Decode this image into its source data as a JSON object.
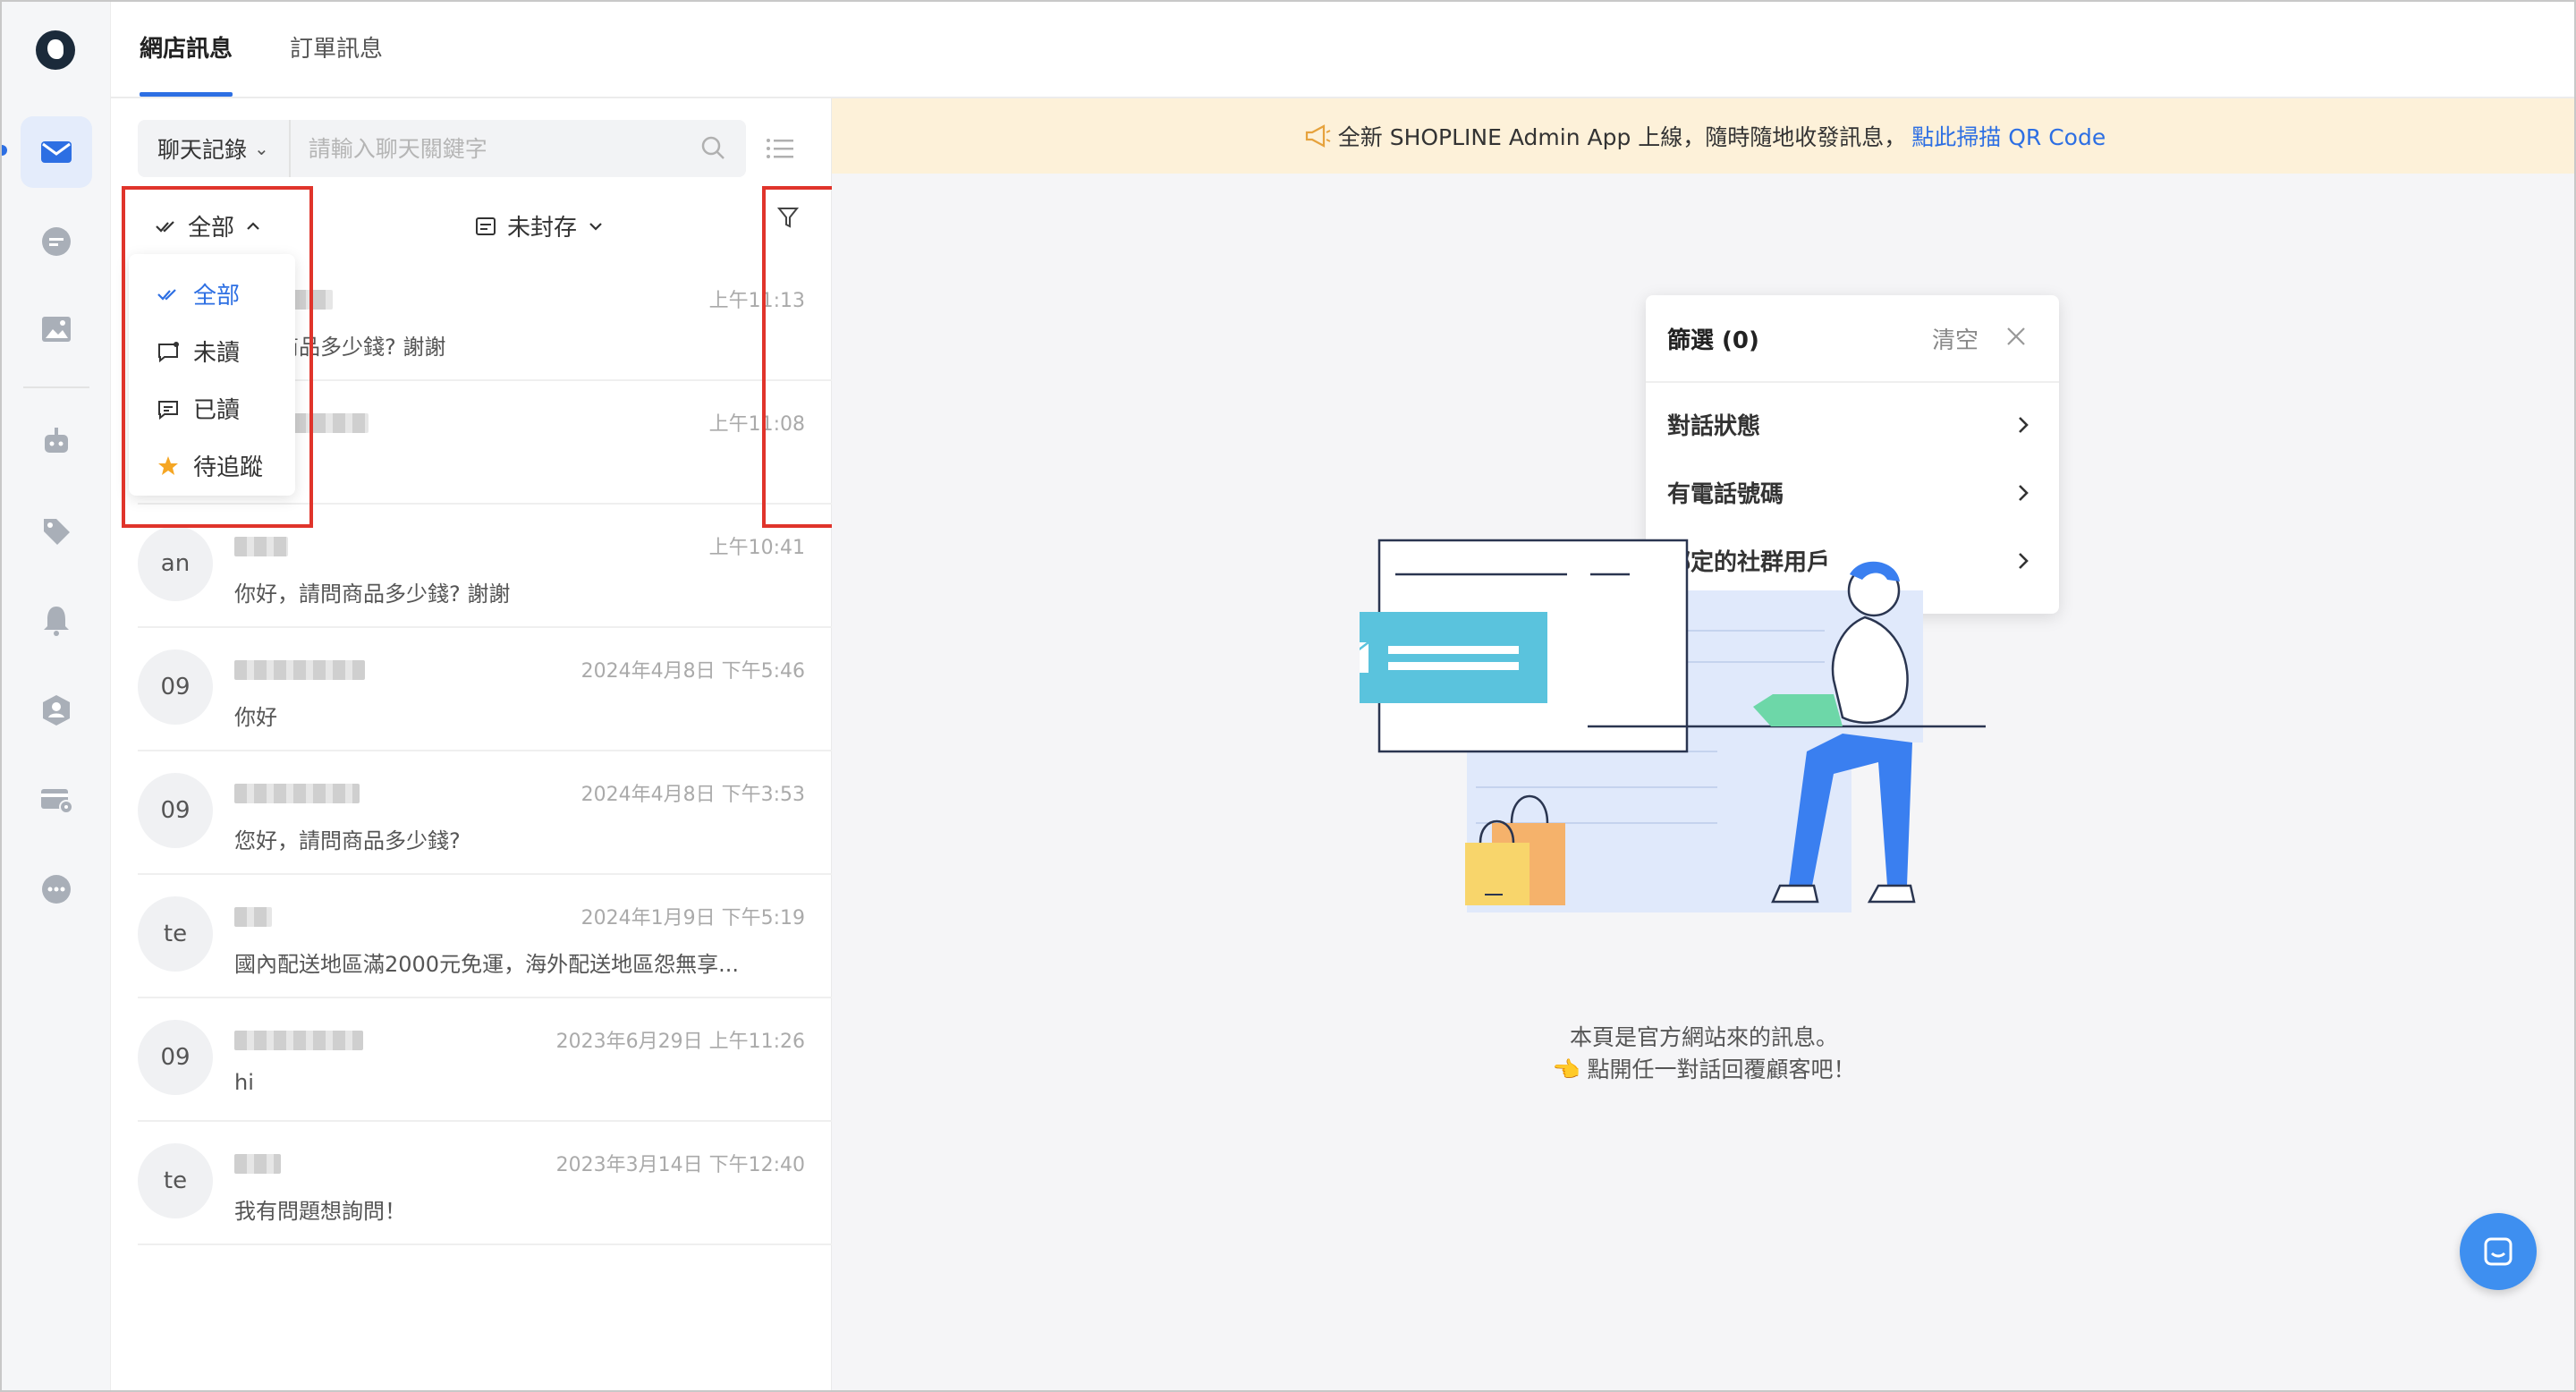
{
  "tabs": [
    "網店訊息",
    "訂單訊息"
  ],
  "search": {
    "mode_label": "聊天記錄",
    "placeholder": "請輸入聊天關鍵字"
  },
  "filters": {
    "read_filter_label": "全部",
    "archive_filter_label": "未封存"
  },
  "read_dropdown": {
    "items": [
      "全部",
      "未讀",
      "已讀",
      "待追蹤"
    ],
    "selected": "全部"
  },
  "conversations": [
    {
      "avatar": "",
      "time": "上午11:13",
      "message": "請問商品多少錢? 謝謝"
    },
    {
      "avatar": "",
      "time": "上午11:08",
      "message": ""
    },
    {
      "avatar": "an",
      "time": "上午10:41",
      "message": "你好，請問商品多少錢? 謝謝"
    },
    {
      "avatar": "09",
      "time": "2024年4月8日 下午5:46",
      "message": "你好"
    },
    {
      "avatar": "09",
      "time": "2024年4月8日 下午3:53",
      "message": "您好，請問商品多少錢?"
    },
    {
      "avatar": "te",
      "time": "2024年1月9日 下午5:19",
      "message": "國內配送地區滿2000元免運，海外配送地區怨無享..."
    },
    {
      "avatar": "09",
      "time": "2023年6月29日 上午11:26",
      "message": "hi"
    },
    {
      "avatar": "te",
      "time": "2023年3月14日 下午12:40",
      "message": "我有問題想詢問！"
    }
  ],
  "banner": {
    "text": "全新 SHOPLINE Admin App 上線，隨時隨地收發訊息，",
    "link": "點此掃描 QR Code"
  },
  "filter_popup": {
    "title": "篩選 (0)",
    "clear_label": "清空",
    "rows": [
      "對話狀態",
      "有電話號碼",
      "綁定的社群用戶"
    ]
  },
  "empty_state": {
    "line1": "本頁是官方網站來的訊息。",
    "line2": "👈 點開任一對話回覆顧客吧！"
  },
  "colors": {
    "accent": "#2d6fe3",
    "banner_bg": "#fdf1d9",
    "highlight_box": "#e0342b"
  }
}
